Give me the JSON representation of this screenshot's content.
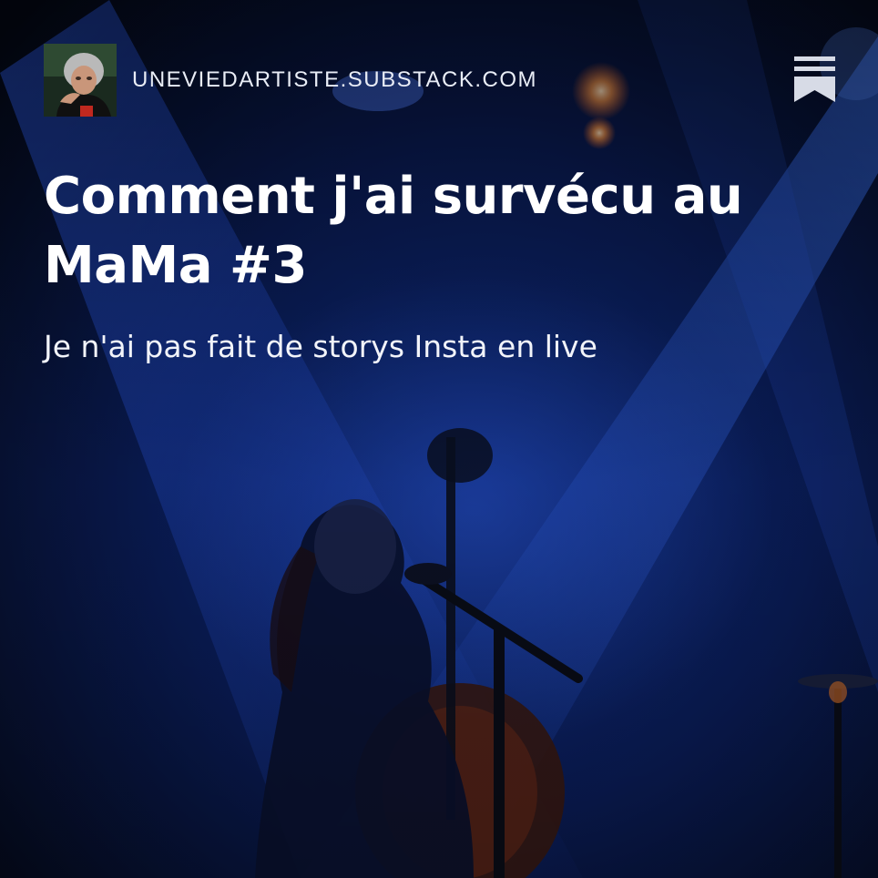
{
  "post": {
    "publication_domain": "UNEVIEDARTISTE.SUBSTACK.COM",
    "title": "Comment j'ai survécu au MaMa #3",
    "subtitle": "Je n'ai pas fait de storys Insta en live"
  },
  "icons": {
    "author_avatar": "author-avatar",
    "publisher_logo": "substack-bookmark-logo"
  },
  "colors": {
    "stage_light_blue": "#1a4fd6",
    "background_dark": "#04070f",
    "text": "#ffffff",
    "spotlight_orange": "#ff8a3c"
  }
}
